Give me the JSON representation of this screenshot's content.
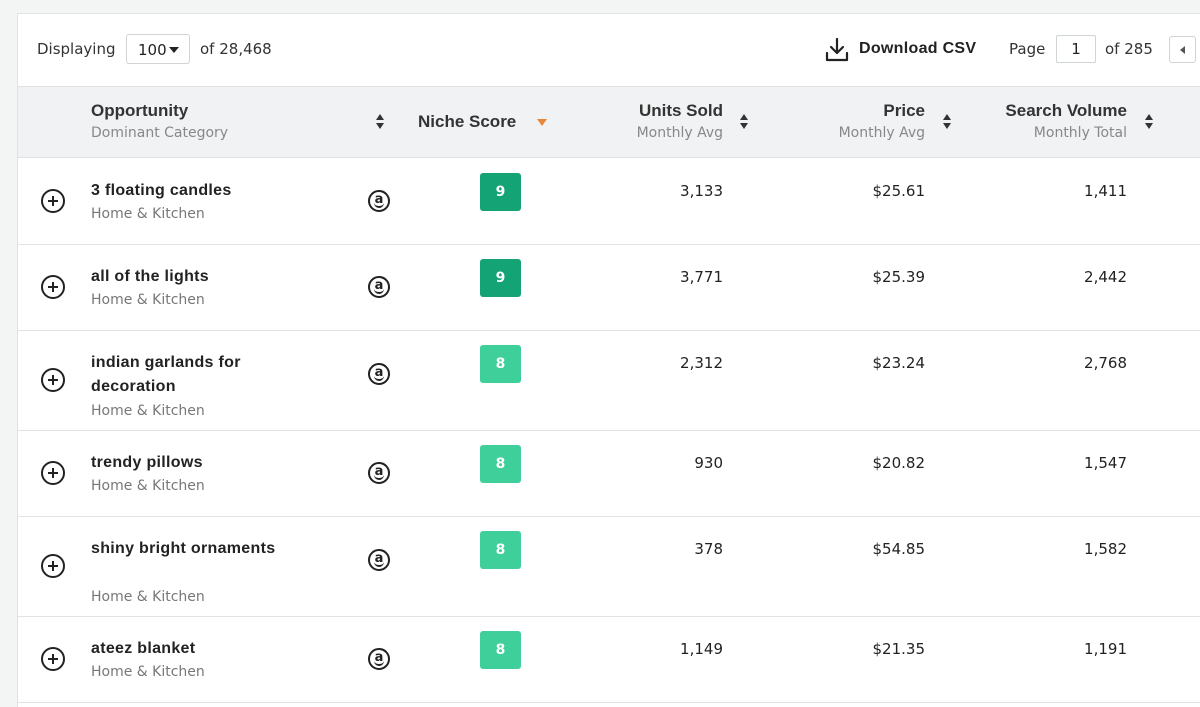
{
  "toolbar": {
    "displaying_label": "Displaying",
    "per_page_value": "100",
    "of_total_label": "of 28,468",
    "download_label": "Download CSV",
    "page_label": "Page",
    "page_value": "1",
    "of_pages_label": "of 285",
    "icons": [
      "download-icon",
      "chevron-down-icon",
      "previous-page-icon"
    ]
  },
  "columns": {
    "opportunity": {
      "label": "Opportunity",
      "sub": "Dominant Category"
    },
    "niche_score": {
      "label": "Niche Score"
    },
    "units_sold": {
      "label": "Units Sold",
      "sub": "Monthly Avg"
    },
    "price": {
      "label": "Price",
      "sub": "Monthly Avg"
    },
    "search_volume": {
      "label": "Search Volume",
      "sub": "Monthly Total"
    }
  },
  "colors": {
    "score_dark": "#13a374",
    "score_light": "#3ecf9a",
    "sort_active": "#e8873a",
    "header_bg": "#f0f2f3"
  },
  "rows": [
    {
      "name": "3 floating candles",
      "category": "Home & Kitchen",
      "marketplace_icon": "amazon-icon",
      "score": "9",
      "units": "3,133",
      "price": "$25.61",
      "volume": "1,411"
    },
    {
      "name": "all of the lights",
      "category": "Home & Kitchen",
      "marketplace_icon": "amazon-icon",
      "score": "9",
      "units": "3,771",
      "price": "$25.39",
      "volume": "2,442"
    },
    {
      "name": "indian garlands for decoration",
      "category": "Home & Kitchen",
      "marketplace_icon": "amazon-icon",
      "score": "8",
      "units": "2,312",
      "price": "$23.24",
      "volume": "2,768"
    },
    {
      "name": "trendy pillows",
      "category": "Home & Kitchen",
      "marketplace_icon": "amazon-icon",
      "score": "8",
      "units": "930",
      "price": "$20.82",
      "volume": "1,547"
    },
    {
      "name": "shiny bright ornaments",
      "category": "Home & Kitchen",
      "marketplace_icon": "amazon-icon",
      "score": "8",
      "units": "378",
      "price": "$54.85",
      "volume": "1,582"
    },
    {
      "name": "ateez blanket",
      "category": "Home & Kitchen",
      "marketplace_icon": "amazon-icon",
      "score": "8",
      "units": "1,149",
      "price": "$21.35",
      "volume": "1,191"
    }
  ]
}
